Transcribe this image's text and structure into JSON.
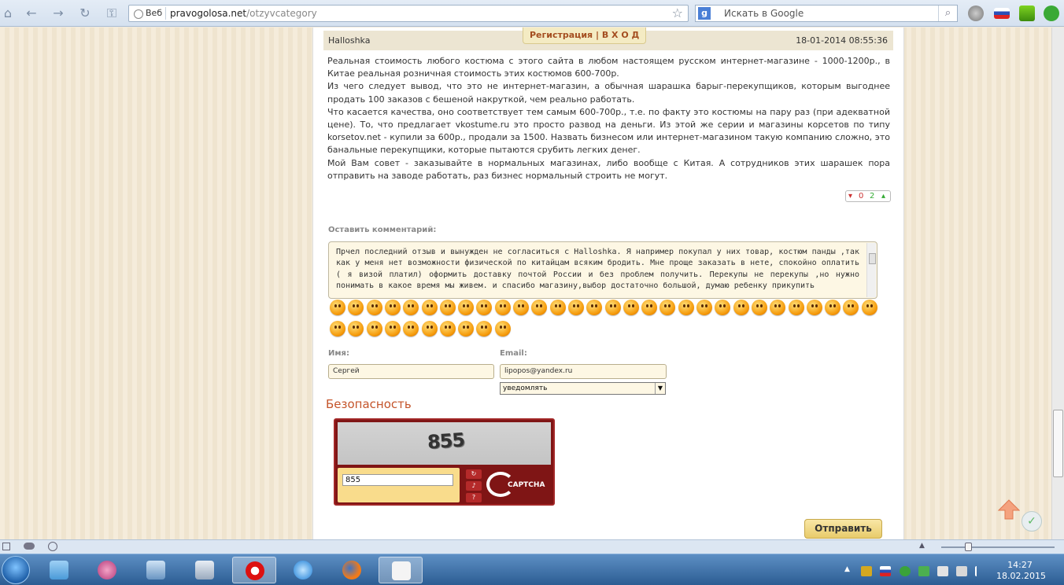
{
  "browser": {
    "site_label": "Веб",
    "url_domain": "pravogolosa.net",
    "url_path": "/otzyvcategory",
    "search_engine_icon": "g",
    "search_placeholder": "Искать в Google"
  },
  "header_tab": {
    "register": "Регистрация",
    "separator": "|",
    "login": "В Х О Д"
  },
  "review": {
    "author": "Halloshka",
    "date": "18-01-2014 08:55:36",
    "paragraphs": [
      "Реальная стоимость любого костюма с этого сайта в любом настоящем русском интернет-магазине - 1000-1200р., в Китае реальная розничная стоимость этих костюмов 600-700р.",
      "Из чего следует вывод, что это не интернет-магазин, а обычная шарашка барыг-перекупщиков, которым выгоднее продать 100 заказов с бешеной накруткой, чем реально работать.",
      "Что касается качества, оно соответствует тем самым 600-700р., т.е. по факту это костюмы на пару раз (при адекватной цене). То, что предлагает vkostume.ru это просто развод на деньги. Из этой же серии и магазины корсетов по типу korsetov.net - купили за 600р., продали за 1500. Назвать бизнесом или интернет-магазином такую компанию сложно, это банальные перекупщики, которые пытаются срубить легких денег.",
      "Мой Вам совет - заказывайте в нормальных магазинах, либо вообще с Китая. А сотрудников этих шарашек пора отправить на заводе работать, раз бизнес нормальный строить не могут."
    ],
    "votes_down": "0",
    "votes_up": "2"
  },
  "comment_form": {
    "label": "Оставить комментарий:",
    "text": "Прчел последний отзыв и вынужден не согласиться с Halloshka. Я например покупал у них товар, костюм панды ,так как у меня нет возможности физической по китайцам всяким бродить. Мне проще заказать в нете, спокойно оплатить ( я визой платил) оформить доставку почтой России и без проблем получить. Перекупы не перекупы ,но нужно понимать в какое время мы живем. и спасибо магазину,выбор достаточно большой, думаю ребенку прикупить",
    "smiley_count": 40,
    "name_label": "Имя:",
    "name_value": "Сергей",
    "email_label": "Email:",
    "email_value": "lipopos@yandex.ru",
    "notify_value": "уведомлять",
    "security_title": "Безопасность",
    "captcha_word": "855",
    "captcha_input": "855",
    "captcha_brand": "CAPTCHA",
    "submit_label": "Отправить"
  },
  "taskbar": {
    "time": "14:27",
    "date": "18.02.2015"
  },
  "colors": {
    "accent": "#c4542a",
    "page_bg": "#f2eadb",
    "captcha_red": "#7f1515"
  }
}
